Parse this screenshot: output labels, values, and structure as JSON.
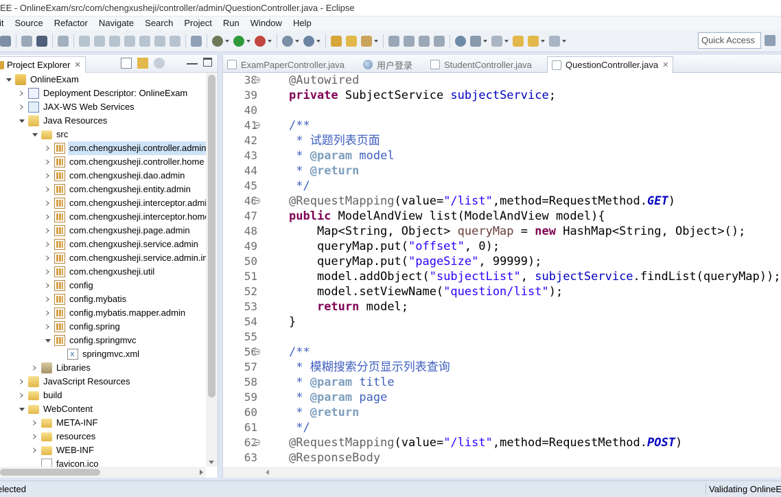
{
  "window": {
    "title": "EE - OnlineExam/src/com/chengxusheji/controller/admin/QuestionController.java - Eclipse"
  },
  "menu": [
    "it",
    "Source",
    "Refactor",
    "Navigate",
    "Search",
    "Project",
    "Run",
    "Window",
    "Help"
  ],
  "toolbar": {
    "quick_access": "Quick Access"
  },
  "explorer": {
    "title": "Project Explorer",
    "close": "✕",
    "tree": [
      {
        "label": "OnlineExam",
        "level": 0,
        "state": "expanded",
        "icon": "project-icon"
      },
      {
        "label": "Deployment Descriptor: OnlineExam",
        "level": 1,
        "state": "collapsed",
        "icon": "deployment-descriptor-icon"
      },
      {
        "label": "JAX-WS Web Services",
        "level": 1,
        "state": "collapsed",
        "icon": "web-services-icon"
      },
      {
        "label": "Java Resources",
        "level": 1,
        "state": "expanded",
        "icon": "java-resources-icon"
      },
      {
        "label": "src",
        "level": 2,
        "state": "expanded",
        "icon": "source-folder-icon"
      },
      {
        "label": "com.chengxusheji.controller.admin",
        "level": 3,
        "state": "collapsed",
        "icon": "package-icon",
        "selected": true
      },
      {
        "label": "com.chengxusheji.controller.home",
        "level": 3,
        "state": "collapsed",
        "icon": "package-icon"
      },
      {
        "label": "com.chengxusheji.dao.admin",
        "level": 3,
        "state": "collapsed",
        "icon": "package-icon"
      },
      {
        "label": "com.chengxusheji.entity.admin",
        "level": 3,
        "state": "collapsed",
        "icon": "package-icon"
      },
      {
        "label": "com.chengxusheji.interceptor.admin",
        "level": 3,
        "state": "collapsed",
        "icon": "package-icon"
      },
      {
        "label": "com.chengxusheji.interceptor.home",
        "level": 3,
        "state": "collapsed",
        "icon": "package-icon"
      },
      {
        "label": "com.chengxusheji.page.admin",
        "level": 3,
        "state": "collapsed",
        "icon": "package-icon"
      },
      {
        "label": "com.chengxusheji.service.admin",
        "level": 3,
        "state": "collapsed",
        "icon": "package-icon"
      },
      {
        "label": "com.chengxusheji.service.admin.impl",
        "level": 3,
        "state": "collapsed",
        "icon": "package-icon"
      },
      {
        "label": "com.chengxusheji.util",
        "level": 3,
        "state": "collapsed",
        "icon": "package-icon"
      },
      {
        "label": "config",
        "level": 3,
        "state": "collapsed",
        "icon": "package-icon"
      },
      {
        "label": "config.mybatis",
        "level": 3,
        "state": "collapsed",
        "icon": "package-icon"
      },
      {
        "label": "config.mybatis.mapper.admin",
        "level": 3,
        "state": "collapsed",
        "icon": "package-icon"
      },
      {
        "label": "config.spring",
        "level": 3,
        "state": "collapsed",
        "icon": "package-icon"
      },
      {
        "label": "config.springmvc",
        "level": 3,
        "state": "expanded",
        "icon": "package-icon"
      },
      {
        "label": "springmvc.xml",
        "level": 4,
        "state": "leaf",
        "icon": "xml-file-icon"
      },
      {
        "label": "Libraries",
        "level": 2,
        "state": "collapsed",
        "icon": "libraries-icon"
      },
      {
        "label": "JavaScript Resources",
        "level": 1,
        "state": "collapsed",
        "icon": "javascript-resources-icon"
      },
      {
        "label": "build",
        "level": 1,
        "state": "collapsed",
        "icon": "folder-icon"
      },
      {
        "label": "WebContent",
        "level": 1,
        "state": "expanded",
        "icon": "folder-icon"
      },
      {
        "label": "META-INF",
        "level": 2,
        "state": "collapsed",
        "icon": "folder-icon"
      },
      {
        "label": "resources",
        "level": 2,
        "state": "collapsed",
        "icon": "folder-icon"
      },
      {
        "label": "WEB-INF",
        "level": 2,
        "state": "collapsed",
        "icon": "folder-icon"
      },
      {
        "label": "favicon.ico",
        "level": 2,
        "state": "leaf",
        "icon": "file-icon"
      }
    ]
  },
  "editor": {
    "tabs": [
      {
        "label": "ExamPaperController.java",
        "icon": "java-file-icon",
        "active": false
      },
      {
        "label": "用户登录",
        "icon": "web-browser-icon",
        "active": false
      },
      {
        "label": "StudentController.java",
        "icon": "java-file-icon",
        "active": false
      },
      {
        "label": "QuestionController.java",
        "icon": "java-file-icon",
        "active": true,
        "close": "✕"
      }
    ],
    "lines": [
      {
        "n": "38",
        "fold": true,
        "t": "@Autowired"
      },
      {
        "n": "39",
        "fold": false,
        "t": "private SubjectService subjectService;"
      },
      {
        "n": "40",
        "fold": false,
        "t": ""
      },
      {
        "n": "41",
        "fold": true,
        "t": "/**"
      },
      {
        "n": "42",
        "fold": false,
        "t": " * 试题列表页面"
      },
      {
        "n": "43",
        "fold": false,
        "t": " * @param model"
      },
      {
        "n": "44",
        "fold": false,
        "t": " * @return"
      },
      {
        "n": "45",
        "fold": false,
        "t": " */"
      },
      {
        "n": "46",
        "fold": true,
        "t": "@RequestMapping(value=\"/list\",method=RequestMethod.GET)"
      },
      {
        "n": "47",
        "fold": false,
        "t": "public ModelAndView list(ModelAndView model){"
      },
      {
        "n": "48",
        "fold": false,
        "t": "    Map<String, Object> queryMap = new HashMap<String, Object>();"
      },
      {
        "n": "49",
        "fold": false,
        "t": "    queryMap.put(\"offset\", 0);"
      },
      {
        "n": "50",
        "fold": false,
        "t": "    queryMap.put(\"pageSize\", 99999);"
      },
      {
        "n": "51",
        "fold": false,
        "t": "    model.addObject(\"subjectList\", subjectService.findList(queryMap));"
      },
      {
        "n": "52",
        "fold": false,
        "t": "    model.setViewName(\"question/list\");"
      },
      {
        "n": "53",
        "fold": false,
        "t": "    return model;"
      },
      {
        "n": "54",
        "fold": false,
        "t": "}"
      },
      {
        "n": "55",
        "fold": false,
        "t": ""
      },
      {
        "n": "56",
        "fold": true,
        "t": "/**"
      },
      {
        "n": "57",
        "fold": false,
        "t": " * 模糊搜索分页显示列表查询"
      },
      {
        "n": "58",
        "fold": false,
        "t": " * @param title"
      },
      {
        "n": "59",
        "fold": false,
        "t": " * @param page"
      },
      {
        "n": "60",
        "fold": false,
        "t": " * @return"
      },
      {
        "n": "61",
        "fold": false,
        "t": " */"
      },
      {
        "n": "62",
        "fold": true,
        "t": "@RequestMapping(value=\"/list\",method=RequestMethod.POST)"
      },
      {
        "n": "63",
        "fold": false,
        "t": "@ResponseBody"
      }
    ]
  },
  "status": {
    "left": "elected",
    "right": "Validating OnlineE"
  }
}
